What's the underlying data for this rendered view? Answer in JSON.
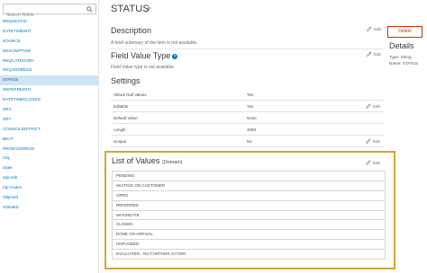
{
  "search": {
    "placeholder": "Search Fields"
  },
  "sidebar": {
    "items": [
      {
        "label": "REQUESTID"
      },
      {
        "label": "DATETIMEINIT"
      },
      {
        "label": "SOURCE"
      },
      {
        "label": "DESCRIPTION"
      },
      {
        "label": "REQCATEGORY"
      },
      {
        "label": "REQADDRESS"
      },
      {
        "label": "STATUS",
        "selected": true
      },
      {
        "label": "REFERREDTO"
      },
      {
        "label": "DATETIMECLOSED"
      },
      {
        "label": "SRX"
      },
      {
        "label": "SRY"
      },
      {
        "label": "COUNCILDISTRICT"
      },
      {
        "label": "BEAT"
      },
      {
        "label": "PROBADDRESS"
      },
      {
        "label": "City"
      },
      {
        "label": "State"
      },
      {
        "label": "Zipcode"
      },
      {
        "label": "Zip Codes"
      },
      {
        "label": "ObjectId"
      },
      {
        "label": "GlobalID"
      }
    ]
  },
  "header": {
    "title": "STATUS"
  },
  "description": {
    "heading": "Description",
    "text": "A brief summary of the item is not available.",
    "edit_label": "Edit"
  },
  "field_value_type": {
    "heading": "Field Value Type",
    "text": "Field Value type is not available.",
    "edit_label": "Edit"
  },
  "settings": {
    "heading": "Settings",
    "rows": [
      {
        "key": "Allows Null Values",
        "value": "Yes",
        "edit": ""
      },
      {
        "key": "Editable",
        "value": "Yes",
        "edit": "Edit"
      },
      {
        "key": "Default Value",
        "value": "None",
        "edit": ""
      },
      {
        "key": "Length",
        "value": "4000",
        "edit": ""
      },
      {
        "key": "Unique",
        "value": "No",
        "edit": "Edit"
      }
    ]
  },
  "domain": {
    "heading": "List of Values",
    "subheading": "(Domain)",
    "edit_label": "Edit",
    "values": [
      "PENDING",
      "WAITING ON CUSTOMER",
      "OPEN",
      "REFERRED",
      "WOCREATE",
      "CLOSED",
      "DONE ON ARRIVAL",
      "UNFUNDED",
      "EVALUATED - NO FURTHER ACTION"
    ]
  },
  "right_panel": {
    "delete_label": "Delete",
    "details_heading": "Details",
    "type_line": "Type: String",
    "name_line": "Name: STATUS"
  },
  "colors": {
    "accent": "#0079c1",
    "selected_bg": "#cfe4f5",
    "highlight_border": "#d3a43a",
    "danger": "#de2900"
  }
}
